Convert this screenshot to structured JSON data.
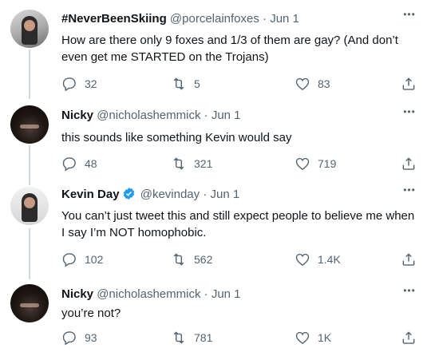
{
  "tweets": [
    {
      "name": "#NeverBeenSkiing",
      "handle": "@porcelainfoxes",
      "dot": "·",
      "date": "Jun 1",
      "text": "How are there only 9 foxes and 1/3 of them are gay? (And don’t even get me STARTED on the Trojans)",
      "replies": "32",
      "retweets": "5",
      "likes": "83",
      "verified": false
    },
    {
      "name": "Nicky",
      "handle": "@nicholashemmick",
      "dot": "·",
      "date": "Jun 1",
      "text": "this sounds like something Kevin would say",
      "replies": "48",
      "retweets": "321",
      "likes": "719",
      "verified": false
    },
    {
      "name": "Kevin Day",
      "handle": "@kevinday",
      "dot": "·",
      "date": "Jun 1",
      "text": "You can’t just tweet this and still expect people to believe me when I say I’m NOT homophobic.",
      "replies": "102",
      "retweets": "562",
      "likes": "1.4K",
      "verified": true
    },
    {
      "name": "Nicky",
      "handle": "@nicholashemmick",
      "dot": "·",
      "date": "Jun 1",
      "text": "you’re not?",
      "replies": "93",
      "retweets": "781",
      "likes": "1K",
      "verified": false
    }
  ],
  "icons": {
    "more": "more-icon",
    "reply": "reply-icon",
    "retweet": "retweet-icon",
    "like": "heart-icon",
    "share": "share-icon",
    "verified": "verified-badge-icon"
  },
  "colors": {
    "text": "#0f1419",
    "secondary": "#536471",
    "verified": "#1d9bf0",
    "thread_line": "#cfd9de"
  }
}
